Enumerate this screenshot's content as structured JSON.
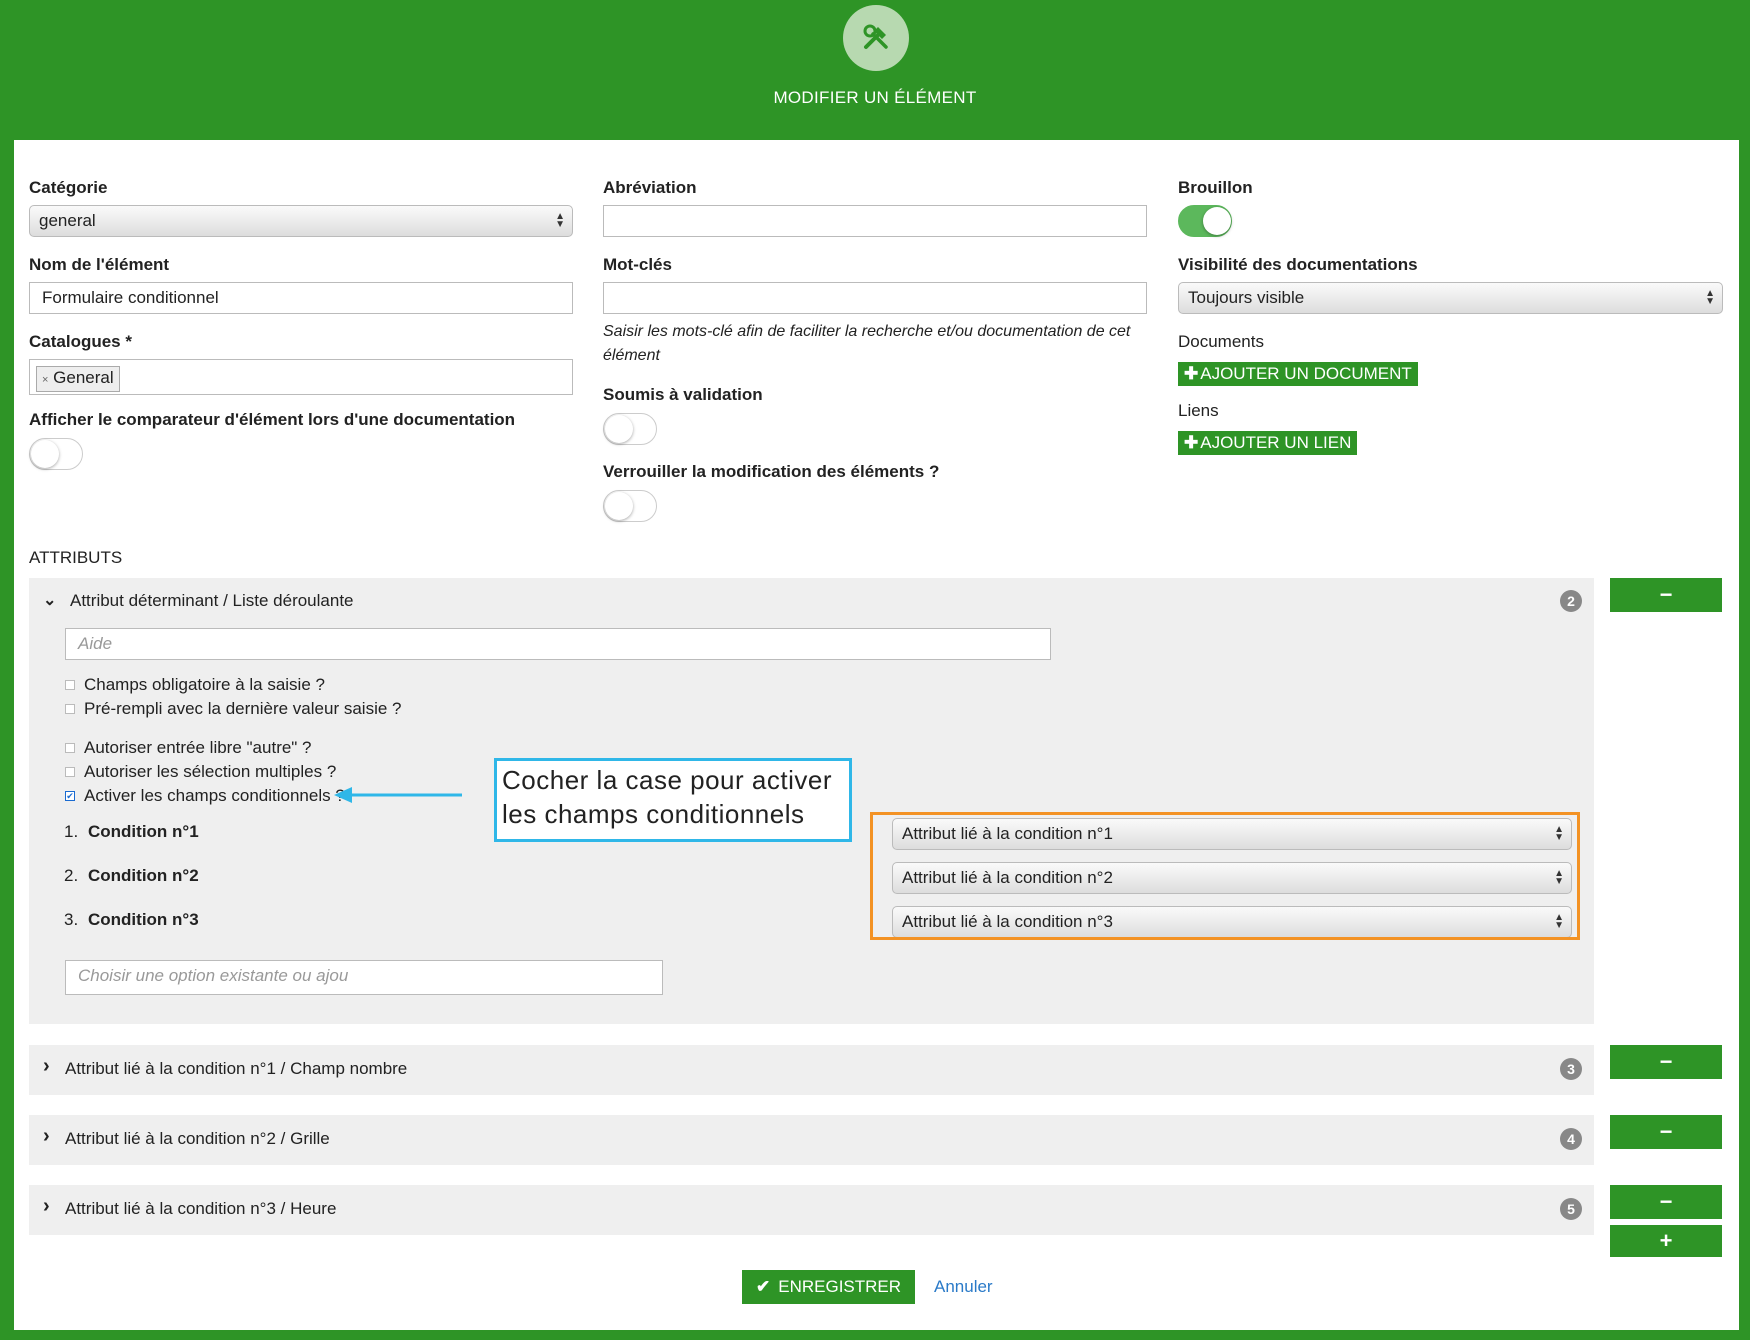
{
  "header": {
    "title": "MODIFIER UN ÉLÉMENT",
    "icon": "tools-icon"
  },
  "form": {
    "categorie": {
      "label": "Catégorie",
      "value": "general"
    },
    "nom": {
      "label": "Nom de l'élément",
      "value": "Formulaire conditionnel"
    },
    "catalogues": {
      "label": "Catalogues *",
      "tag": "General",
      "tag_remove": "×"
    },
    "comparateur": {
      "label": "Afficher le comparateur d'élément lors d'une documentation"
    },
    "abreviation": {
      "label": "Abréviation",
      "value": ""
    },
    "motscles": {
      "label": "Mot-clés",
      "value": "",
      "hint": "Saisir les mots-clé afin de faciliter la recherche et/ou documentation de cet élément"
    },
    "soumis": {
      "label": "Soumis à validation"
    },
    "verrouiller": {
      "label": "Verrouiller la modification des éléments ?"
    },
    "brouillon": {
      "label": "Brouillon"
    },
    "visibilite": {
      "label": "Visibilité des documentations",
      "value": "Toujours visible"
    },
    "documents": {
      "label": "Documents",
      "button": "AJOUTER UN DOCUMENT"
    },
    "liens": {
      "label": "Liens",
      "button": "AJOUTER UN LIEN"
    }
  },
  "attributs": {
    "heading": "ATTRIBUTS",
    "main": {
      "title": "Attribut déterminant / Liste déroulante",
      "badge": "2",
      "aide_placeholder": "Aide",
      "checkboxes": [
        {
          "label": "Champs obligatoire à la saisie ?",
          "checked": false
        },
        {
          "label": "Pré-rempli avec la dernière valeur saisie ?",
          "checked": false
        },
        {
          "label": "Autoriser entrée libre \"autre\" ?",
          "checked": false
        },
        {
          "label": "Autoriser les sélection multiples ?",
          "checked": false
        },
        {
          "label": "Activer les champs conditionnels ?",
          "checked": true
        }
      ],
      "conditions": [
        {
          "num": "1.",
          "label": "Condition n°1",
          "select": "Attribut lié à la condition n°1"
        },
        {
          "num": "2.",
          "label": "Condition n°2",
          "select": "Attribut lié à la condition n°2"
        },
        {
          "num": "3.",
          "label": "Condition n°3",
          "select": "Attribut lié à la condition n°3"
        }
      ],
      "option_placeholder": "Choisir une option existante ou ajou"
    },
    "collapsed": [
      {
        "title": "Attribut lié à la condition n°1 / Champ nombre",
        "badge": "3"
      },
      {
        "title": "Attribut lié à la condition n°2 / Grille",
        "badge": "4"
      },
      {
        "title": "Attribut lié à la condition n°3 / Heure",
        "badge": "5"
      }
    ],
    "minus": "−",
    "plus": "+"
  },
  "callout": {
    "line1": "Cocher la case pour activer",
    "line2": "les champs conditionnels"
  },
  "actions": {
    "save": "ENREGISTRER",
    "cancel": "Annuler"
  },
  "colors": {
    "brand_green": "#2e9426",
    "callout_blue": "#2fb7e8",
    "highlight_orange": "#f39224"
  }
}
